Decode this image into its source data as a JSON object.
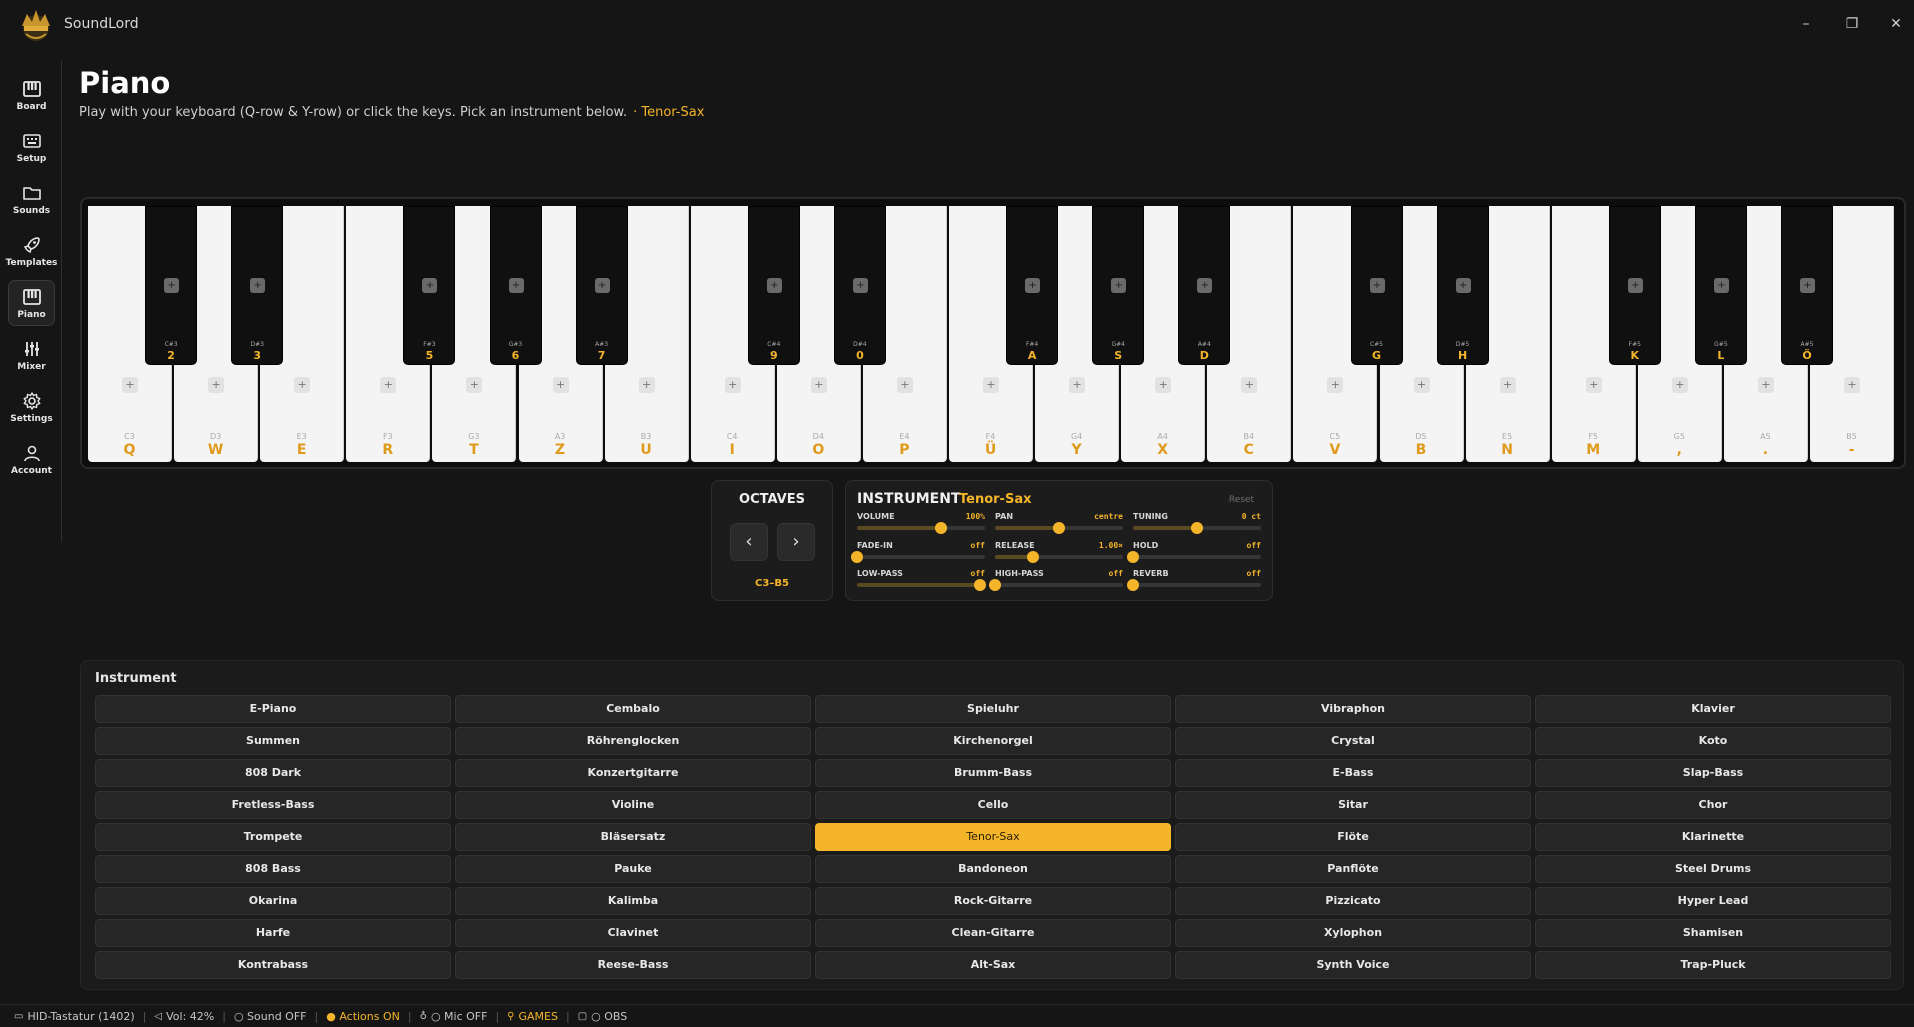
{
  "app": {
    "title": "SoundLord"
  },
  "window": {
    "minimize": "–",
    "maximize": "❐",
    "close": "✕"
  },
  "sidebar": {
    "items": [
      {
        "label": "Board",
        "icon": "piano-icon",
        "active": false
      },
      {
        "label": "Setup",
        "icon": "keyboard-icon",
        "active": false
      },
      {
        "label": "Sounds",
        "icon": "folder-icon",
        "active": false
      },
      {
        "label": "Templates",
        "icon": "rocket-icon",
        "active": false
      },
      {
        "label": "Piano",
        "icon": "piano-icon",
        "active": true
      },
      {
        "label": "Mixer",
        "icon": "sliders-icon",
        "active": false
      },
      {
        "label": "Settings",
        "icon": "gear-icon",
        "active": false
      },
      {
        "label": "Account",
        "icon": "user-icon",
        "active": false
      }
    ]
  },
  "header": {
    "title": "Piano",
    "subtitle": "Play with your keyboard (Q-row & Y-row) or click the keys. Pick an instrument below.",
    "current_instrument": "· Tenor-Sax"
  },
  "keyboard": {
    "white_keys": [
      {
        "note": "C3",
        "key": "Q"
      },
      {
        "note": "D3",
        "key": "W"
      },
      {
        "note": "E3",
        "key": "E"
      },
      {
        "note": "F3",
        "key": "R"
      },
      {
        "note": "G3",
        "key": "T"
      },
      {
        "note": "A3",
        "key": "Z"
      },
      {
        "note": "B3",
        "key": "U"
      },
      {
        "note": "C4",
        "key": "I"
      },
      {
        "note": "D4",
        "key": "O"
      },
      {
        "note": "E4",
        "key": "P"
      },
      {
        "note": "F4",
        "key": "Ü"
      },
      {
        "note": "G4",
        "key": "Y"
      },
      {
        "note": "A4",
        "key": "X"
      },
      {
        "note": "B4",
        "key": "C"
      },
      {
        "note": "C5",
        "key": "V"
      },
      {
        "note": "D5",
        "key": "B"
      },
      {
        "note": "E5",
        "key": "N"
      },
      {
        "note": "F5",
        "key": "M"
      },
      {
        "note": "G5",
        "key": ","
      },
      {
        "note": "A5",
        "key": "."
      },
      {
        "note": "B5",
        "key": "-"
      }
    ],
    "black_keys": [
      {
        "note": "C#3",
        "key": "2"
      },
      {
        "note": "D#3",
        "key": "3"
      },
      {
        "note": "F#3",
        "key": "5"
      },
      {
        "note": "G#3",
        "key": "6"
      },
      {
        "note": "A#3",
        "key": "7"
      },
      {
        "note": "C#4",
        "key": "9"
      },
      {
        "note": "D#4",
        "key": "0"
      },
      {
        "note": "F#4",
        "key": "A"
      },
      {
        "note": "G#4",
        "key": "S"
      },
      {
        "note": "A#4",
        "key": "D"
      },
      {
        "note": "C#5",
        "key": "G"
      },
      {
        "note": "D#5",
        "key": "H"
      },
      {
        "note": "F#5",
        "key": "K"
      },
      {
        "note": "G#5",
        "key": "L"
      },
      {
        "note": "A#5",
        "key": "Ö"
      }
    ],
    "plus_label": "+"
  },
  "octaves": {
    "title": "OCTAVES",
    "prev_label": "‹",
    "next_label": "›",
    "range": "C3–B5"
  },
  "instrument_settings": {
    "title": "INSTRUMENT",
    "name": "Tenor-Sax",
    "reset_label": "Reset",
    "controls": [
      {
        "label": "VOLUME",
        "value": "100%",
        "level": 0.66
      },
      {
        "label": "PAN",
        "value": "centre",
        "level": 0.5
      },
      {
        "label": "TUNING",
        "value": "0 ct",
        "level": 0.5
      },
      {
        "label": "FADE-IN",
        "value": "off",
        "level": 0.0
      },
      {
        "label": "RELEASE",
        "value": "1.00×",
        "level": 0.3
      },
      {
        "label": "HOLD",
        "value": "off",
        "level": 0.0
      },
      {
        "label": "LOW-PASS",
        "value": "off",
        "level": 0.96
      },
      {
        "label": "HIGH-PASS",
        "value": "off",
        "level": 0.0
      },
      {
        "label": "REVERB",
        "value": "off",
        "level": 0.0
      }
    ]
  },
  "instruments": {
    "title": "Instrument",
    "selected": "Tenor-Sax",
    "items": [
      "E-Piano",
      "Cembalo",
      "Spieluhr",
      "Vibraphon",
      "Klavier",
      "Summen",
      "Röhrenglocken",
      "Kirchenorgel",
      "Crystal",
      "Koto",
      "808 Dark",
      "Konzertgitarre",
      "Brumm-Bass",
      "E-Bass",
      "Slap-Bass",
      "Fretless-Bass",
      "Violine",
      "Cello",
      "Sitar",
      "Chor",
      "Trompete",
      "Bläsersatz",
      "Tenor-Sax",
      "Flöte",
      "Klarinette",
      "808 Bass",
      "Pauke",
      "Bandoneon",
      "Panflöte",
      "Steel Drums",
      "Okarina",
      "Kalimba",
      "Rock-Gitarre",
      "Pizzicato",
      "Hyper Lead",
      "Harfe",
      "Clavinet",
      "Clean-Gitarre",
      "Xylophon",
      "Shamisen",
      "Kontrabass",
      "Reese-Bass",
      "Alt-Sax",
      "Synth Voice",
      "Trap-Pluck"
    ]
  },
  "statusbar": {
    "device": "HID-Tastatur (1402)",
    "volume": "Vol: 42%",
    "sound": "○ Sound OFF",
    "actions": "● Actions ON",
    "mic": "○ Mic OFF",
    "games": "GAMES",
    "obs": "○ OBS"
  },
  "colors": {
    "accent": "#f5b52a",
    "background": "#151515",
    "panel": "#1c1c1c"
  }
}
